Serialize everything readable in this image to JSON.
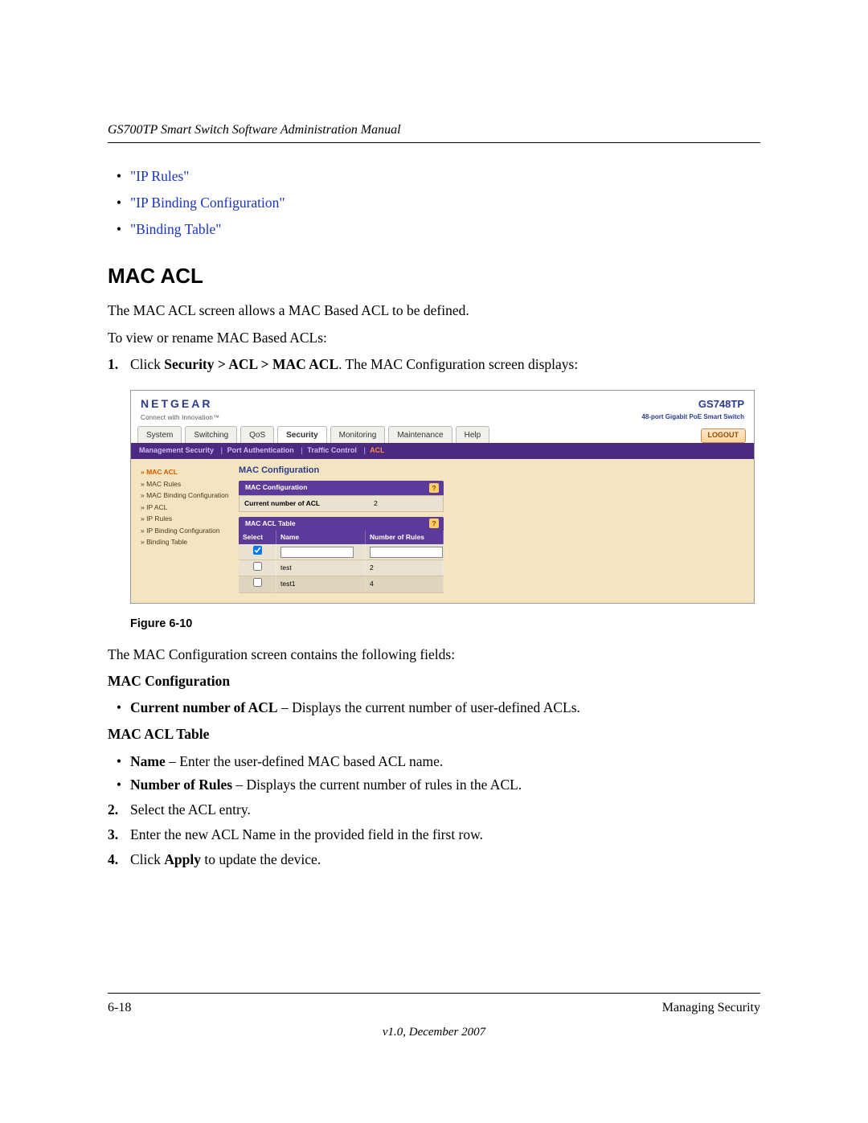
{
  "header": {
    "running_head": "GS700TP Smart Switch Software Administration Manual"
  },
  "top_links": {
    "ip_rules": "\"IP Rules\"",
    "ip_binding_cfg": "\"IP Binding Configuration\"",
    "binding_table": "\"Binding Table\""
  },
  "section": {
    "title": "MAC ACL",
    "intro1": "The MAC ACL screen allows a MAC Based ACL to be defined.",
    "intro2": "To view or rename MAC Based ACLs:",
    "step1_prefix": "Click ",
    "step1_bold": "Security > ACL > MAC ACL",
    "step1_suffix": ". The MAC Configuration screen displays:"
  },
  "app": {
    "brand": "NETGEAR",
    "brand_tag": "Connect with Innovation™",
    "model": "GS748TP",
    "model_desc": "48-port Gigabit PoE Smart Switch",
    "tabs": [
      "System",
      "Switching",
      "QoS",
      "Security",
      "Monitoring",
      "Maintenance",
      "Help"
    ],
    "tab_active_index": 3,
    "logout": "LOGOUT",
    "subnav": {
      "items": [
        "Management Security",
        "Port Authentication",
        "Traffic Control",
        "ACL"
      ],
      "active_index": 3
    },
    "sidebar": [
      "MAC ACL",
      "MAC Rules",
      "MAC Binding Configuration",
      "IP ACL",
      "IP Rules",
      "IP Binding Configuration",
      "Binding Table"
    ],
    "sidebar_active_index": 0,
    "panel_title": "MAC Configuration",
    "mac_cfg": {
      "head": "MAC Configuration",
      "key": "Current number of ACL",
      "val": "2"
    },
    "mac_table": {
      "head": "MAC ACL Table",
      "cols": {
        "select": "Select",
        "name": "Name",
        "rules": "Number of Rules"
      },
      "rows": [
        {
          "name": "test",
          "rules": "2"
        },
        {
          "name": "test1",
          "rules": "4"
        }
      ]
    }
  },
  "figure_caption": "Figure 6-10",
  "post": {
    "fields_intro": "The MAC Configuration screen contains the following fields:",
    "mac_cfg_head": "MAC Configuration",
    "curr_acl_label": "Current number of ACL",
    "curr_acl_desc": " – Displays the current number of user-defined ACLs.",
    "mac_table_head": "MAC ACL Table",
    "name_label": "Name",
    "name_desc": " – Enter the user-defined MAC based ACL name.",
    "numrules_label": "Number of Rules",
    "numrules_desc": " – Displays the current number of rules in the ACL.",
    "step2": "Select the ACL entry.",
    "step3": "Enter the new ACL Name in the provided field in the first row.",
    "step4_prefix": "Click ",
    "step4_bold": "Apply",
    "step4_suffix": " to update the device."
  },
  "footer": {
    "page": "6-18",
    "chapter": "Managing Security",
    "version": "v1.0, December 2007"
  }
}
